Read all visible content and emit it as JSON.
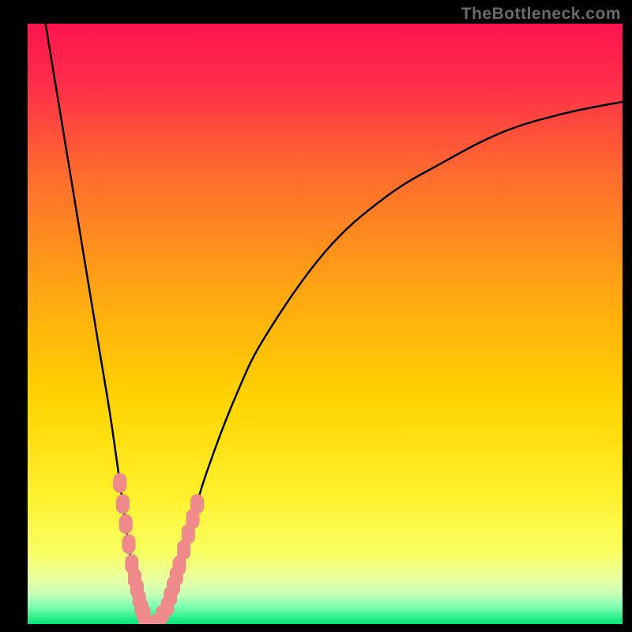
{
  "attribution": "TheBottleneck.com",
  "chart_data": {
    "type": "line",
    "title": "",
    "xlabel": "",
    "ylabel": "",
    "xlim": [
      0,
      100
    ],
    "ylim": [
      0,
      100
    ],
    "x_min_visible": 3,
    "x_optimum": 20,
    "curve_points": [
      {
        "x": 3,
        "y": 100
      },
      {
        "x": 5,
        "y": 88
      },
      {
        "x": 8,
        "y": 70
      },
      {
        "x": 10,
        "y": 58
      },
      {
        "x": 12,
        "y": 46
      },
      {
        "x": 14,
        "y": 34
      },
      {
        "x": 16,
        "y": 20
      },
      {
        "x": 17.5,
        "y": 10
      },
      {
        "x": 19,
        "y": 3
      },
      {
        "x": 20,
        "y": 0.5
      },
      {
        "x": 22,
        "y": 0.5
      },
      {
        "x": 23.5,
        "y": 3
      },
      {
        "x": 25,
        "y": 8
      },
      {
        "x": 27,
        "y": 15
      },
      {
        "x": 30,
        "y": 25
      },
      {
        "x": 35,
        "y": 38
      },
      {
        "x": 40,
        "y": 48
      },
      {
        "x": 50,
        "y": 62
      },
      {
        "x": 60,
        "y": 71
      },
      {
        "x": 70,
        "y": 77
      },
      {
        "x": 80,
        "y": 82
      },
      {
        "x": 90,
        "y": 85
      },
      {
        "x": 100,
        "y": 87
      }
    ],
    "marker_clusters": [
      {
        "side": "left",
        "x_range": [
          15.5,
          17.5
        ],
        "y_range": [
          10,
          25
        ]
      },
      {
        "side": "left",
        "x_range": [
          18,
          19.5
        ],
        "y_range": [
          1,
          9
        ]
      },
      {
        "side": "bottom",
        "x_range": [
          20,
          23
        ],
        "y_range": [
          0,
          2
        ]
      },
      {
        "side": "right",
        "x_range": [
          23.5,
          25.5
        ],
        "y_range": [
          3,
          12
        ]
      },
      {
        "side": "right",
        "x_range": [
          25.5,
          28.5
        ],
        "y_range": [
          12,
          22
        ]
      }
    ],
    "gradient_colors": {
      "top": "#ff1450",
      "mid": "#ffd200",
      "near_bottom": "#f9ff60",
      "bottom": "#00e676"
    },
    "marker_color": "#ef8a8a",
    "curve_color": "#000000"
  }
}
